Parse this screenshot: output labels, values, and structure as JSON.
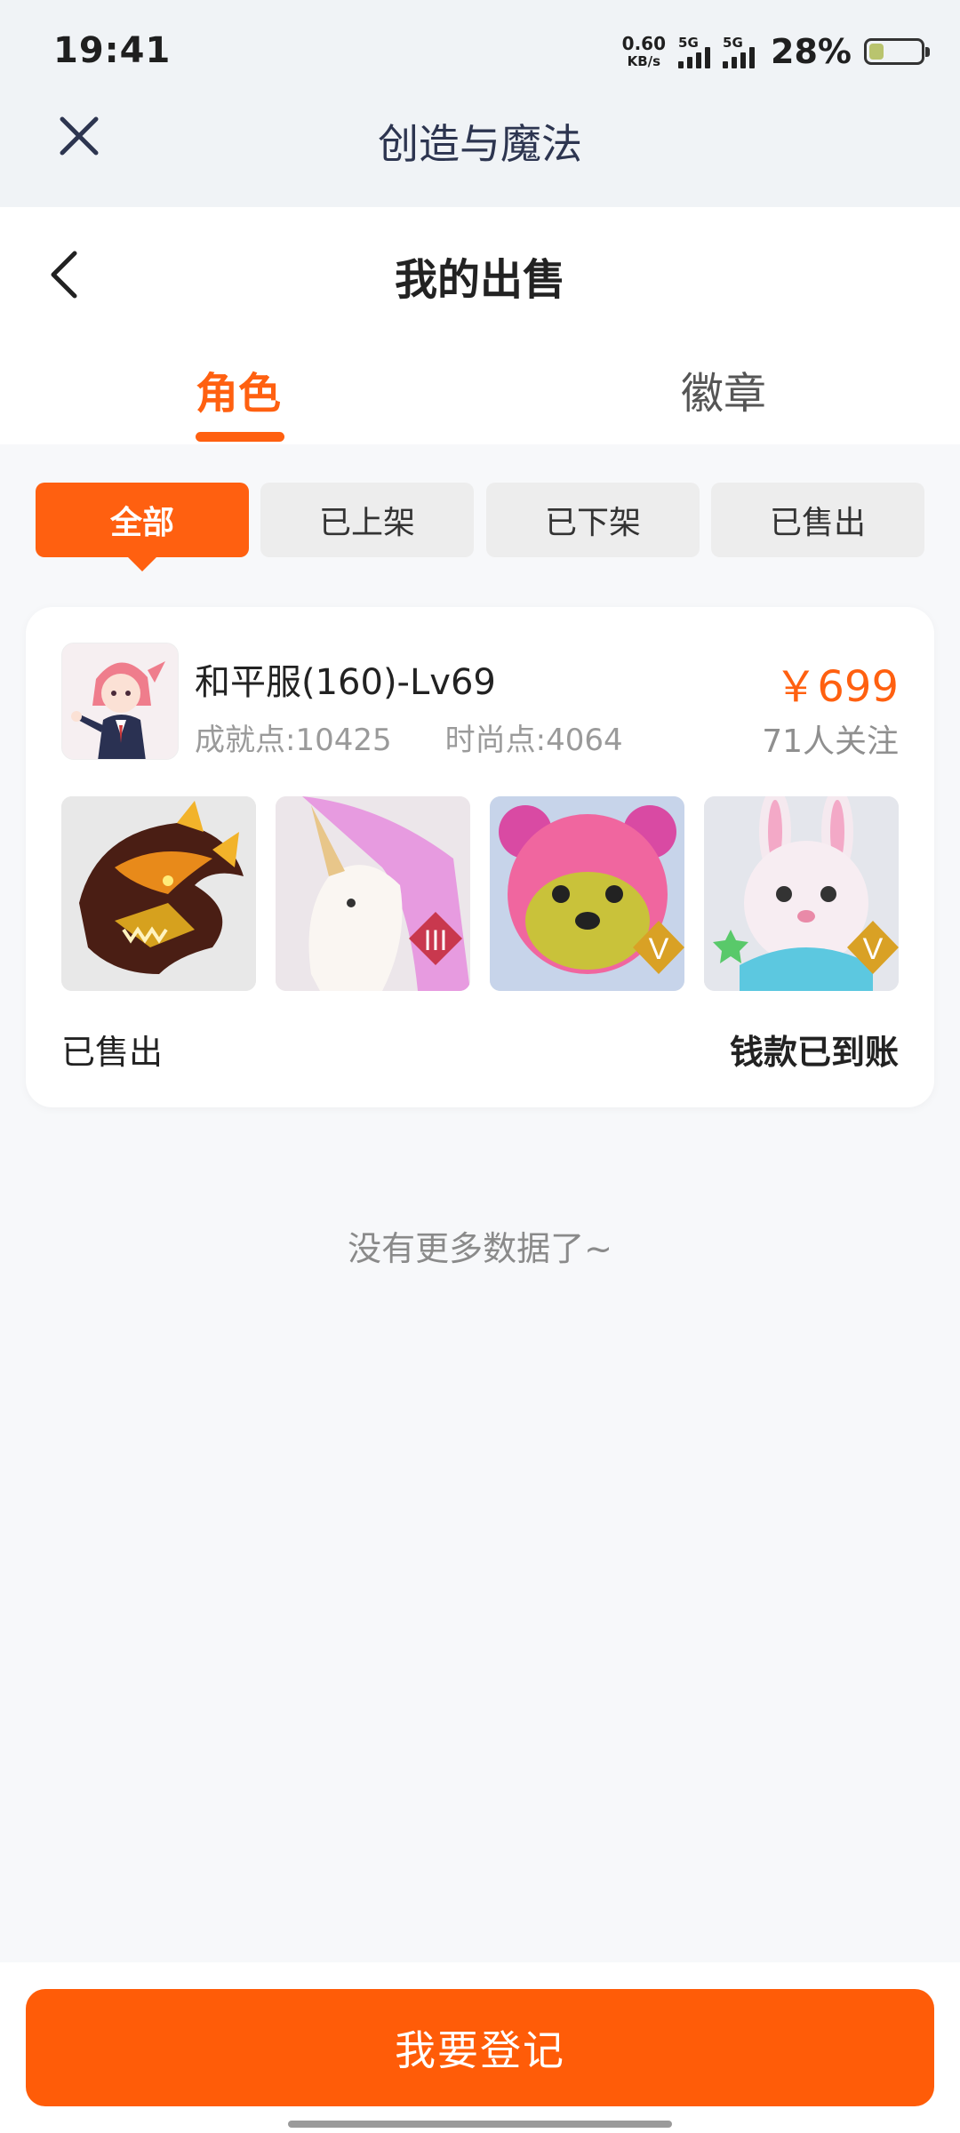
{
  "status_bar": {
    "time": "19:41",
    "net_speed_value": "0.60",
    "net_speed_unit": "KB/s",
    "sim1_label": "5G",
    "sim2_label": "5G",
    "battery_percent": "28%",
    "battery_level": 0.28
  },
  "mini_app": {
    "title": "创造与魔法",
    "close_icon": "close-icon"
  },
  "page": {
    "title": "我的出售",
    "back_icon": "chevron-left-icon"
  },
  "tabs": [
    {
      "label": "角色",
      "active": true
    },
    {
      "label": "徽章",
      "active": false
    }
  ],
  "filters": [
    {
      "label": "全部",
      "active": true
    },
    {
      "label": "已上架",
      "active": false
    },
    {
      "label": "已下架",
      "active": false
    },
    {
      "label": "已售出",
      "active": false
    }
  ],
  "listing": {
    "name": "和平服(160)-Lv69",
    "achievement": "成就点:10425",
    "fashion": "时尚点:4064",
    "price": "￥699",
    "followers": "71人关注",
    "items": [
      {
        "icon": "dragon-mount-icon"
      },
      {
        "icon": "unicorn-mount-icon",
        "badge": "III"
      },
      {
        "icon": "pink-bear-pet-icon",
        "badge": "V"
      },
      {
        "icon": "bunny-pet-icon",
        "badge": "V"
      }
    ],
    "status": "已售出",
    "payment_status": "钱款已到账"
  },
  "empty_hint": "没有更多数据了~",
  "action": {
    "register_label": "我要登记"
  },
  "colors": {
    "accent": "#ff6010",
    "button": "#ff5c08",
    "background": "#f7f8fa"
  }
}
